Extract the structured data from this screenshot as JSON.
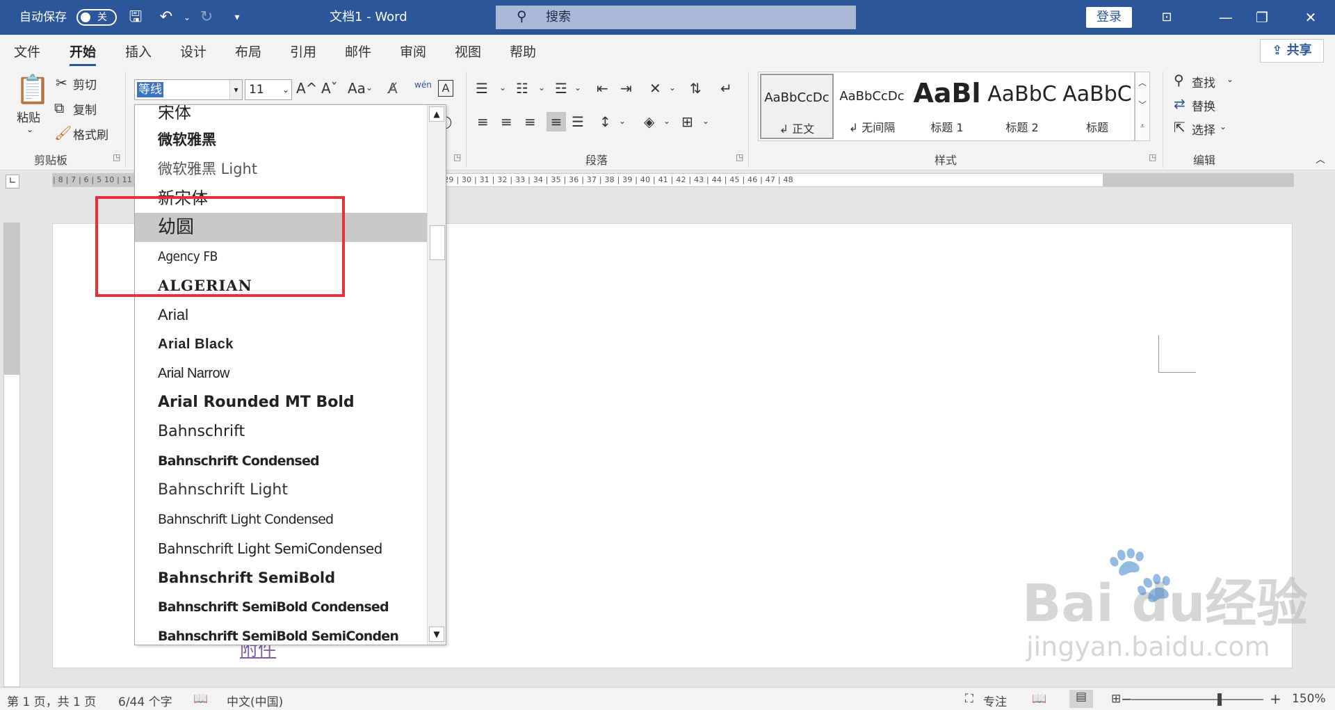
{
  "titlebar": {
    "autosave_label": "自动保存",
    "autosave_state": "关",
    "doc_title": "文档1  -  Word",
    "search_placeholder": "搜索",
    "login": "登录",
    "bg_color": "#2b579a"
  },
  "tabs": [
    "文件",
    "开始",
    "插入",
    "设计",
    "布局",
    "引用",
    "邮件",
    "审阅",
    "视图",
    "帮助"
  ],
  "active_tab": "开始",
  "share_label": "共享",
  "ribbon": {
    "clipboard": {
      "label": "剪贴板",
      "paste": "粘贴",
      "cut": "剪切",
      "copy": "复制",
      "format_painter": "格式刷"
    },
    "font": {
      "name": "等线",
      "size": "11",
      "grow": "A^",
      "shrink": "Aˇ",
      "case": "Aa",
      "phonetic": "wén"
    },
    "paragraph": {
      "label": "段落"
    },
    "styles": {
      "label": "样式",
      "items": [
        {
          "preview": "AaBbCcDc",
          "name": "↲ 正文"
        },
        {
          "preview": "AaBbCcDc",
          "name": "↲ 无间隔"
        },
        {
          "preview": "AaBl",
          "name": "标题 1"
        },
        {
          "preview": "AaBbC",
          "name": "标题 2"
        },
        {
          "preview": "AaBbC",
          "name": "标题"
        }
      ]
    },
    "editing": {
      "label": "编辑",
      "find": "查找",
      "replace": "替换",
      "select": "选择"
    }
  },
  "ruler_numbers": "| 8 | 7 | 6 | 5                                                                                                                                                    10 | 11 | 12 | 13 | 14 | 15 | 16 | 17 | 18 | 19 | 20 | 21 | 22 | 23 | 24 | 25 | 26 | 27 | 28 | 29 | 30 | 31 | 32 | 33 | 34 | 35 | 36 | 37 | 38 | 39 | 40 | 41 | 42 | 43 | 44 | 45 | 46 | 47 | 48",
  "font_list": [
    "宋体",
    "微软雅黑",
    "微软雅黑 Light",
    "新宋体",
    "幼圆",
    "Agency FB",
    "ALGERIAN",
    "Arial",
    "Arial Black",
    "Arial Narrow",
    "Arial Rounded MT Bold",
    "Bahnschrift",
    "Bahnschrift Condensed",
    "Bahnschrift Light",
    "Bahnschrift Light Condensed",
    "Bahnschrift Light SemiCondensed",
    "Bahnschrift SemiBold",
    "Bahnschrift SemiBold Condensed",
    "Bahnschrift SemiBold SemiConden"
  ],
  "highlighted_font": "幼圆",
  "document": {
    "visible_text": "附件"
  },
  "statusbar": {
    "page": "第 1 页，共 1 页",
    "words": "6/44 个字",
    "language": "中文(中国)",
    "focus": "专注",
    "zoom": "150%"
  },
  "watermark": {
    "brand": "Bai  du经验",
    "url": "jingyan.baidu.com"
  },
  "accent_red": "#e8303a"
}
